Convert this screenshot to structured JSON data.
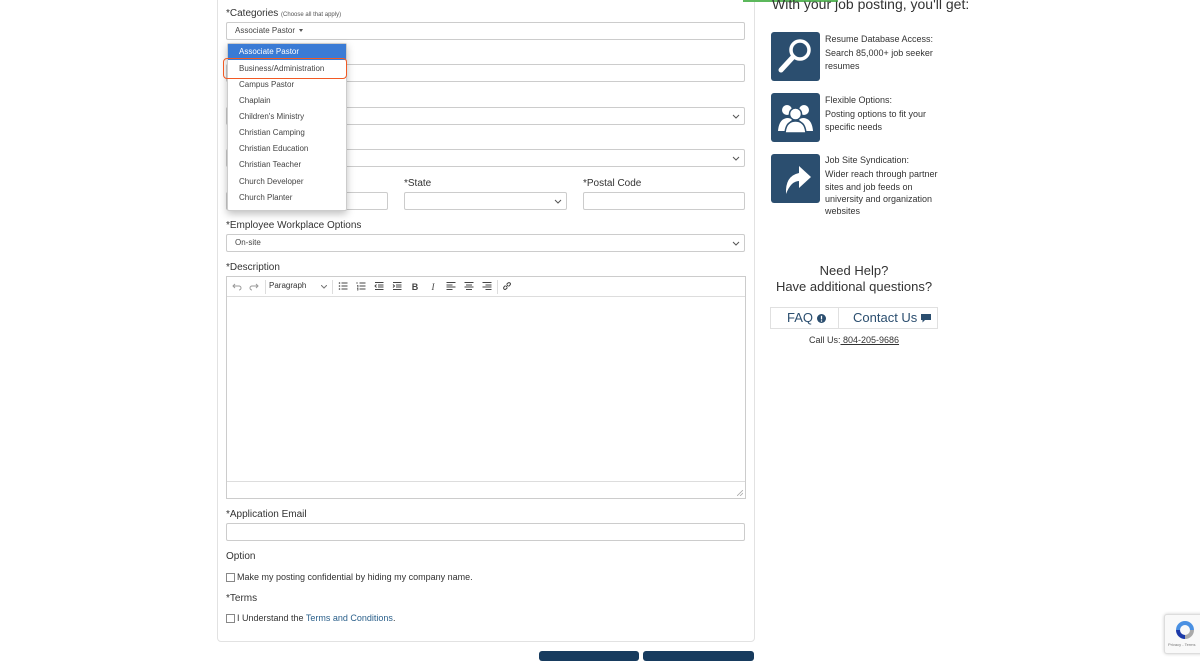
{
  "form": {
    "categories": {
      "label": "*Categories",
      "hint": "(Choose all that apply)",
      "selected": "Associate Pastor"
    },
    "dropdown_options": [
      "Associate Pastor",
      "Business/Administration",
      "Campus Pastor",
      "Chaplain",
      "Children's Ministry",
      "Christian Camping",
      "Christian Education",
      "Christian Teacher",
      "Church Developer",
      "Church Planter"
    ],
    "state_label": "*State",
    "postal_label": "*Postal Code",
    "workplace": {
      "label": "*Employee Workplace Options",
      "value": "On-site"
    },
    "description": {
      "label": "*Description",
      "paragraph": "Paragraph"
    },
    "application_email_label": "*Application Email",
    "option": {
      "label": "Option",
      "confidential": "Make my posting confidential by hiding my company name."
    },
    "terms": {
      "label": "*Terms",
      "text_prefix": "I Understand the ",
      "link": "Terms and Conditions",
      "text_suffix": "."
    }
  },
  "sidebar": {
    "title": "With your job posting, you'll get:",
    "features": [
      {
        "title": "Resume Database Access:",
        "text": "Search 85,000+ job seeker resumes",
        "icon": "magnifier-icon"
      },
      {
        "title": "Flexible Options:",
        "text": "Posting options to fit your specific needs",
        "icon": "people-icon"
      },
      {
        "title": "Job Site Syndication:",
        "text": "Wider reach through partner sites and job feeds on university and organization websites",
        "icon": "share-arrow-icon"
      }
    ],
    "help_line1": "Need Help?",
    "help_line2": "Have additional questions?",
    "faq": "FAQ",
    "contact": "Contact Us",
    "call_label": "Call Us:",
    "phone": " 804-205-9686"
  },
  "recaptcha": {
    "text": "Privacy - Terms"
  },
  "colors": {
    "accent": "#2b4e6f",
    "selected_option": "#3a7bd5",
    "highlight": "#f15a24",
    "green": "#5cb85c"
  }
}
